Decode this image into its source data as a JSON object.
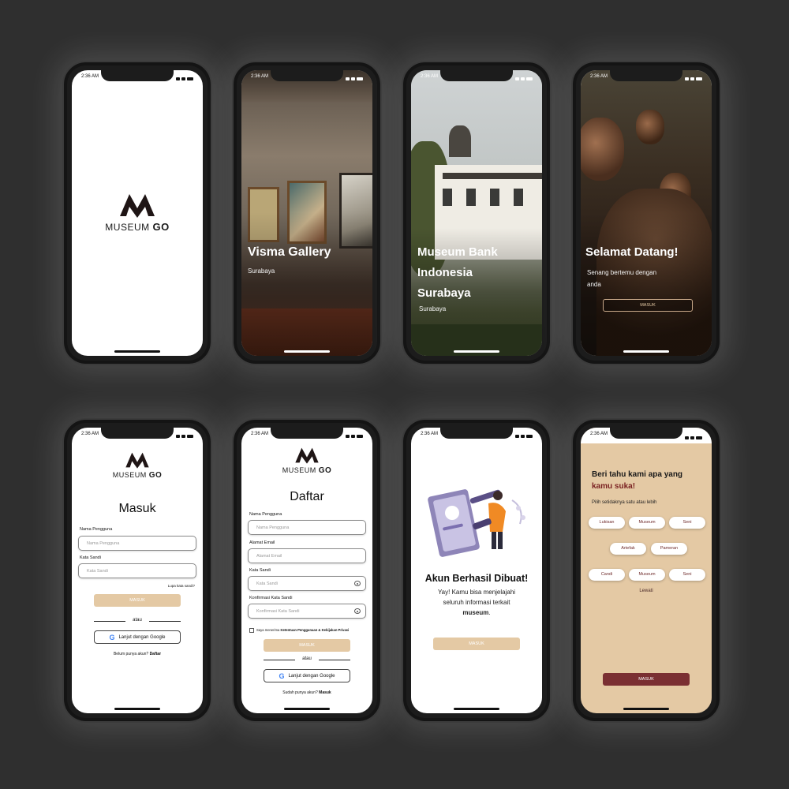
{
  "status_time": "2:36 AM",
  "colors": {
    "beige": "#e4c9a4",
    "maroon": "#7a2f32",
    "accent_text": "#7a2222"
  },
  "brand": {
    "museum": "MUSEUM",
    "go": "GO"
  },
  "screens": {
    "visma": {
      "title": "Visma Gallery",
      "subtitle": "Surabaya"
    },
    "bank": {
      "title_line1": "Museum Bank",
      "title_line2": "Indonesia",
      "title_line3": "Surabaya",
      "subtitle": "Surabaya"
    },
    "welcome": {
      "title": "Selamat Datang!",
      "subtitle_line1": "Senang bertemu dengan",
      "subtitle_line2": "anda",
      "button": "MASUK"
    },
    "login": {
      "title": "Masuk",
      "username_label": "Nama Pengguna",
      "username_placeholder": "Nama Pengguna",
      "password_label": "Kata Sandi",
      "password_placeholder": "Kata Sandi",
      "forgot": "Lupa kata sandi?",
      "button": "MASUK",
      "or": "atau",
      "google": "Lanjut dengan Google",
      "footer_text": "Belum punya akun?",
      "footer_link": "Daftar"
    },
    "register": {
      "title": "Daftar",
      "username_label": "Nama  Pengguna",
      "username_placeholder": "Nama  Pengguna",
      "email_label": "Alamat Email",
      "email_placeholder": "Alamat Email",
      "password_label": "Kata Sandi",
      "password_placeholder": "Kata Sandi",
      "confirm_label": "Konfirmasi Kata Sandi",
      "confirm_placeholder": "Konfirmasi Kata Sandi",
      "agree_prefix": "Saya menerima",
      "agree_link": "Ketentuan Penggunaan & Kebijakan Privasi",
      "button": "MASUK",
      "or": "atau",
      "google": "Lanjut dengan Google",
      "footer_text": "Sudah punya akun?",
      "footer_link": "Masuk"
    },
    "success": {
      "title": "Akun Berhasil Dibuat!",
      "body_line1": "Yay! Kamu bisa menjelajahi",
      "body_line2": "seluruh informasi terkait",
      "body_bold": "museum",
      "body_end": ".",
      "button": "MASUK"
    },
    "interest": {
      "title_line1": "Beri tahu kami apa yang",
      "title_line2": "kamu suka!",
      "subtitle": "Pilih setidaknya satu atau lebih",
      "chips": [
        "Lukisan",
        "Museum",
        "Seni",
        "Artefak",
        "Pameran",
        "Candi",
        "Museum",
        "Seni"
      ],
      "skip": "Lewati",
      "button": "MASUK"
    }
  }
}
